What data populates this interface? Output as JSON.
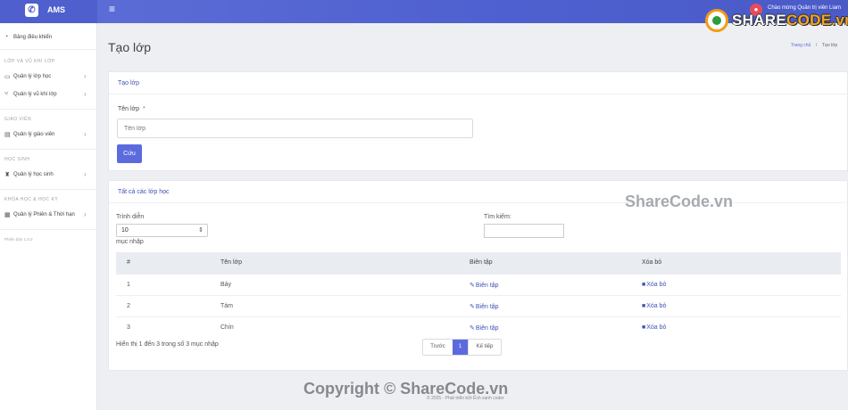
{
  "app": {
    "name": "AMS",
    "logo_icon": "phone-icon",
    "menu_icon": "hamburger-icon"
  },
  "user": {
    "welcome": "Chào mừng Quản trị viên Liam"
  },
  "watermark": {
    "logo_prefix": "SHARE",
    "logo_suffix": "CODE.vn",
    "mid": "ShareCode.vn",
    "footer": "Copyright © ShareCode.vn"
  },
  "sidebar": {
    "dashboard": "Bảng điều khiển",
    "sections": [
      {
        "title": "LỚP VÀ VŨ KHÍ LỚP",
        "items": [
          "Quản lý lớp học",
          "Quản lý vũ khí lớp"
        ]
      },
      {
        "title": "GIÁO VIÊN",
        "items": [
          "Quản lý giáo viên"
        ]
      },
      {
        "title": "HỌC SINH",
        "items": [
          "Quản lý học sinh"
        ]
      },
      {
        "title": "KHÓA HỌC & HỌC KỲ",
        "items": [
          "Quản lý Phiên & Thời hạn"
        ]
      }
    ],
    "version": "Phiên bản 1.0.0"
  },
  "page": {
    "title": "Tạo lớp",
    "breadcrumb": {
      "home": "Trang chủ",
      "sep": "/",
      "current": "Tạo lớp"
    }
  },
  "create_form": {
    "title": "Tạo lớp",
    "label": "Tên lớp",
    "required_mark": "*",
    "placeholder": "Tên lớp",
    "save": "Cứu"
  },
  "list": {
    "title": "Tất cả các lớp học",
    "show_label": "Trình diễn",
    "page_size": "10",
    "entries_label": "mục nhập",
    "search_label": "Tìm kiếm:",
    "columns": [
      "#",
      "Tên lớp",
      "Biên tập",
      "Xóa bỏ"
    ],
    "rows": [
      {
        "num": "1",
        "name": "Bảy",
        "edit": "Biên tập",
        "delete": "Xóa bỏ"
      },
      {
        "num": "2",
        "name": "Tám",
        "edit": "Biên tập",
        "delete": "Xóa bỏ"
      },
      {
        "num": "3",
        "name": "Chín",
        "edit": "Biên tập",
        "delete": "Xóa bỏ"
      }
    ],
    "info": "Hiển thị 1 đến 3 trong số 3 mục nhập",
    "pager": {
      "prev": "Trước",
      "current": "1",
      "next": "Kế tiếp"
    }
  },
  "footer": "© 2025 - Phát triển bởi Ếch xanh coder"
}
